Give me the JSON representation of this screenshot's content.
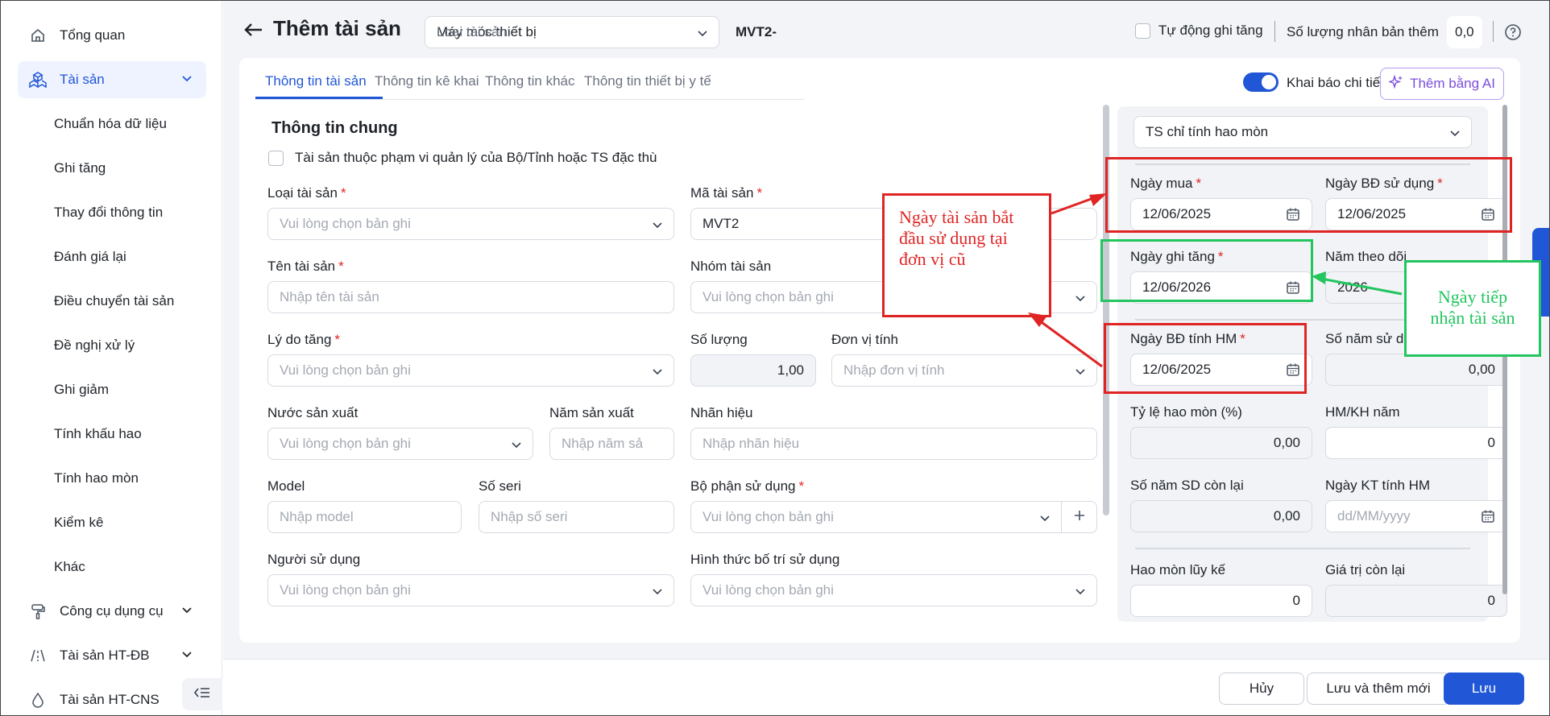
{
  "sidebar": {
    "overview": "Tổng quan",
    "assets": "Tài sản",
    "sub_items": [
      "Chuẩn hóa dữ liệu",
      "Ghi tăng",
      "Thay đổi thông tin",
      "Đánh giá lại",
      "Điều chuyển tài sản",
      "Đề nghị xử lý",
      "Ghi giảm",
      "Tính khấu hao",
      "Tính hao mòn",
      "Kiểm kê",
      "Khác"
    ],
    "tools": "Công cụ dụng cụ",
    "infra_road": "Tài sản HT-ĐB",
    "infra_water": "Tài sản HT-CNS"
  },
  "header": {
    "title": "Thêm tài sản",
    "type_label": "Loại tài sản:",
    "type_value": "Máy móc thiết bị",
    "code": "MVT2-",
    "auto_label": "Tự động ghi tăng",
    "clone_label": "Số lượng nhân bản thêm",
    "clone_value": "0,0"
  },
  "tabs": [
    "Thông tin tài sản",
    "Thông tin kê khai",
    "Thông tin khác",
    "Thông tin thiết bị y tế"
  ],
  "detail_toggle_label": "Khai báo chi tiết",
  "ai_button": "Thêm bằng AI",
  "general": {
    "title": "Thông tin chung",
    "scope_checkbox": "Tài sản thuộc phạm vi quản lý của Bộ/Tỉnh hoặc TS đặc thù",
    "asset_type_label": "Loại tài sản",
    "asset_type_ph": "Vui lòng chọn bản ghi",
    "asset_code_label": "Mã tài sản",
    "asset_code_value": "MVT2",
    "asset_name_label": "Tên tài sản",
    "asset_name_ph": "Nhập tên tài sản",
    "asset_group_label": "Nhóm tài sản",
    "asset_group_ph": "Vui lòng chọn bản ghi",
    "reason_label": "Lý do tăng",
    "reason_ph": "Vui lòng chọn bản ghi",
    "qty_label": "Số lượng",
    "qty_value": "1,00",
    "unit_label": "Đơn vị tính",
    "unit_ph": "Nhập đơn vị tính",
    "country_label": "Nước sản xuất",
    "country_ph": "Vui lòng chọn bản ghi",
    "year_label": "Năm sản xuất",
    "year_ph": "Nhập năm sả",
    "brand_label": "Nhãn hiệu",
    "brand_ph": "Nhập nhãn hiệu",
    "model_label": "Model",
    "model_ph": "Nhập model",
    "serial_label": "Số seri",
    "serial_ph": "Nhập số seri",
    "dept_label": "Bộ phận sử dụng",
    "dept_ph": "Vui lòng chọn bản ghi",
    "user_label": "Người sử dụng",
    "user_ph": "Vui lòng chọn bản ghi",
    "arrange_label": "Hình thức bố trí sử dụng",
    "arrange_ph": "Vui lòng chọn bản ghi"
  },
  "depreciation": {
    "mode": "TS chỉ tính hao mòn",
    "buy_date_label": "Ngày mua",
    "buy_date": "12/06/2025",
    "use_date_label": "Ngày BĐ sử dụng",
    "use_date": "12/06/2025",
    "record_date_label": "Ngày ghi tăng",
    "record_date": "12/06/2026",
    "track_year_label": "Năm theo dõi",
    "track_year": "2026",
    "dep_start_label": "Ngày BĐ tính HM",
    "dep_start": "12/06/2025",
    "years_label": "Số năm sử dụng",
    "years_value": "0,00",
    "rate_label": "Tỷ lệ hao mòn (%)",
    "rate_value": "0,00",
    "annual_label": "HM/KH năm",
    "annual_value": "0",
    "remaining_years_label": "Số năm SD còn lại",
    "remaining_years_value": "0,00",
    "dep_end_label": "Ngày KT tính HM",
    "dep_end_ph": "dd/MM/yyyy",
    "accum_label": "Hao mòn lũy kế",
    "accum_value": "0",
    "residual_label": "Giá trị còn lại",
    "residual_value": "0"
  },
  "annotations": {
    "red_note": "Ngày tài sản bắt đầu sử dụng tại đơn vị cũ",
    "green_note": "Ngày tiếp nhận tài sản",
    "red_color": "#e02424",
    "green_color": "#22c55e"
  },
  "footer": {
    "cancel": "Hủy",
    "save_new": "Lưu và thêm mới",
    "save": "Lưu"
  },
  "colors": {
    "accent": "#2157d6",
    "ai": "#7c4ddb"
  }
}
